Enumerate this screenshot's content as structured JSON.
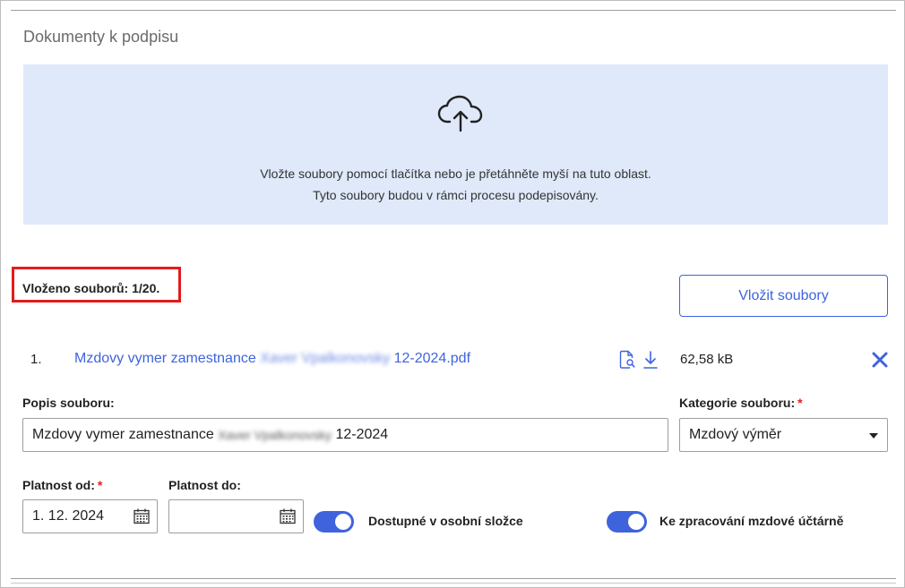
{
  "section": {
    "title": "Dokumenty k podpisu"
  },
  "dropzone": {
    "icon": "cloud-upload-icon",
    "line1": "Vložte soubory pomocí tlačítka nebo je přetáhněte myší na tuto oblast.",
    "line2": "Tyto soubory budou v rámci procesu podepisovány."
  },
  "upload": {
    "count_text": "Vloženo souborů: 1/20.",
    "button_label": "Vložit soubory"
  },
  "file": {
    "index": "1.",
    "name_prefix": "Mzdovy vymer zamestnance ",
    "name_redacted": "Xaver Vpalkonovsky",
    "name_suffix": " 12-2024.pdf",
    "size": "62,58 kB",
    "icons": [
      "preview-icon",
      "download-icon",
      "close-icon"
    ]
  },
  "form": {
    "description_label": "Popis souboru:",
    "description_prefix": "Mzdovy vymer zamestnance ",
    "description_redacted": "Xaver Vpalkonovsky",
    "description_suffix": " 12-2024",
    "category_label": "Kategorie souboru:",
    "category_required": "*",
    "category_value": "Mzdový výměr",
    "valid_from_label": "Platnost od:",
    "valid_from_required": "*",
    "valid_from_value": "1. 12. 2024",
    "valid_to_label": "Platnost do:",
    "valid_to_value": ""
  },
  "toggles": {
    "personal_folder_label": "Dostupné v osobní složce",
    "personal_folder_on": true,
    "payroll_label": "Ke zpracování mzdové účtárně",
    "payroll_on": true
  },
  "colors": {
    "accent": "#3e63dd",
    "dropzone_bg": "#dfe9fa",
    "highlight": "#e41b1b"
  }
}
